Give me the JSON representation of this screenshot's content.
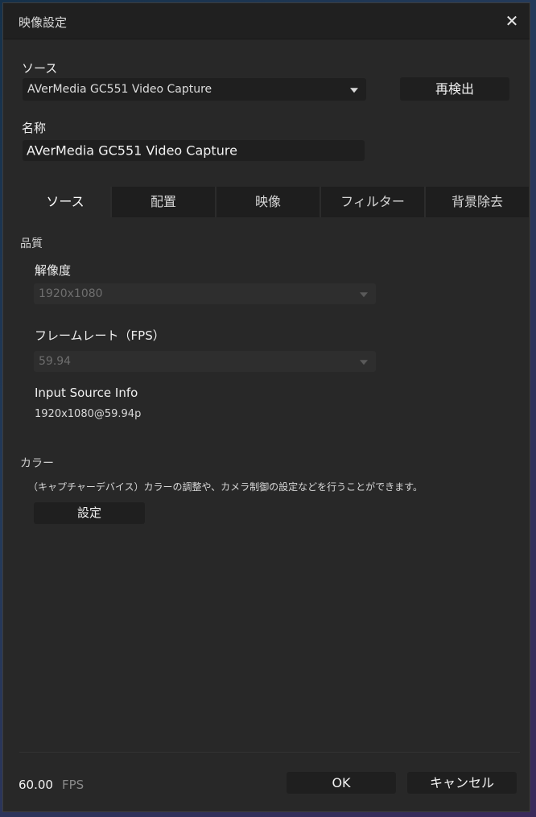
{
  "dialog": {
    "title": "映像設定",
    "close_icon": "close-icon"
  },
  "source": {
    "label": "ソース",
    "device_value": "AVerMedia GC551 Video Capture",
    "redetect_label": "再検出"
  },
  "name": {
    "label": "名称",
    "value": "AVerMedia GC551 Video Capture"
  },
  "tabs": [
    {
      "label": "ソース",
      "active": true
    },
    {
      "label": "配置",
      "active": false
    },
    {
      "label": "映像",
      "active": false
    },
    {
      "label": "フィルター",
      "active": false
    },
    {
      "label": "背景除去",
      "active": false
    }
  ],
  "quality": {
    "section_label": "品質",
    "resolution_label": "解像度",
    "resolution_value": "1920x1080",
    "framerate_label": "フレームレート（FPS）",
    "framerate_value": "59.94",
    "input_info_label": "Input Source Info",
    "input_info_value": "1920x1080@59.94p"
  },
  "color": {
    "section_label": "カラー",
    "description": "（キャプチャーデバイス）カラーの調整や、カメラ制御の設定などを行うことができます。",
    "settings_label": "設定"
  },
  "footer": {
    "fps_value": "60.00",
    "fps_unit": "FPS",
    "ok_label": "OK",
    "cancel_label": "キャンセル"
  }
}
